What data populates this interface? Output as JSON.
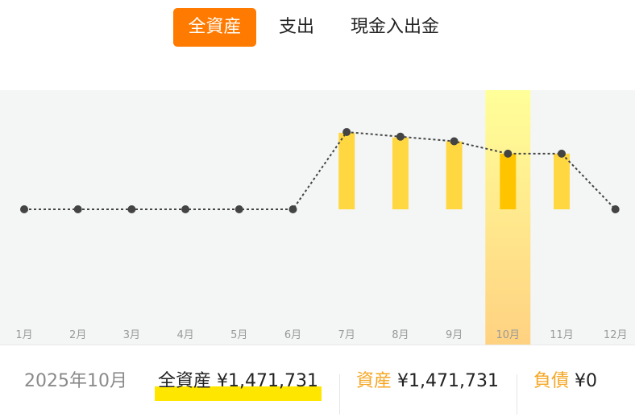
{
  "tabs": [
    {
      "label": "全資産",
      "active": true
    },
    {
      "label": "支出",
      "active": false
    },
    {
      "label": "現金入出金",
      "active": false
    }
  ],
  "chart_data": {
    "type": "bar",
    "categories": [
      "1月",
      "2月",
      "3月",
      "4月",
      "5月",
      "6月",
      "7月",
      "8月",
      "9月",
      "10月",
      "11月",
      "12月"
    ],
    "series": [
      {
        "type": "bar",
        "values": [
          null,
          null,
          null,
          null,
          null,
          null,
          0.99,
          0.93,
          0.88,
          0.72,
          0.72,
          null
        ]
      },
      {
        "type": "line",
        "values": [
          0,
          0,
          0,
          0,
          0,
          0,
          1.0,
          0.94,
          0.88,
          0.72,
          0.72,
          0
        ]
      }
    ],
    "selected_index": 9,
    "colors": {
      "bar": "#ffd740",
      "bar_selected": "#ffc400",
      "line": "#444444",
      "highlight_top": "#ffff99",
      "highlight_bottom": "#ffcf80"
    }
  },
  "summary": {
    "month": "2025年10月",
    "total_label": "全資産",
    "total_value": "¥1,471,731",
    "assets_label": "資産",
    "assets_value": "¥1,471,731",
    "debts_label": "負債",
    "debts_value": "¥0"
  }
}
